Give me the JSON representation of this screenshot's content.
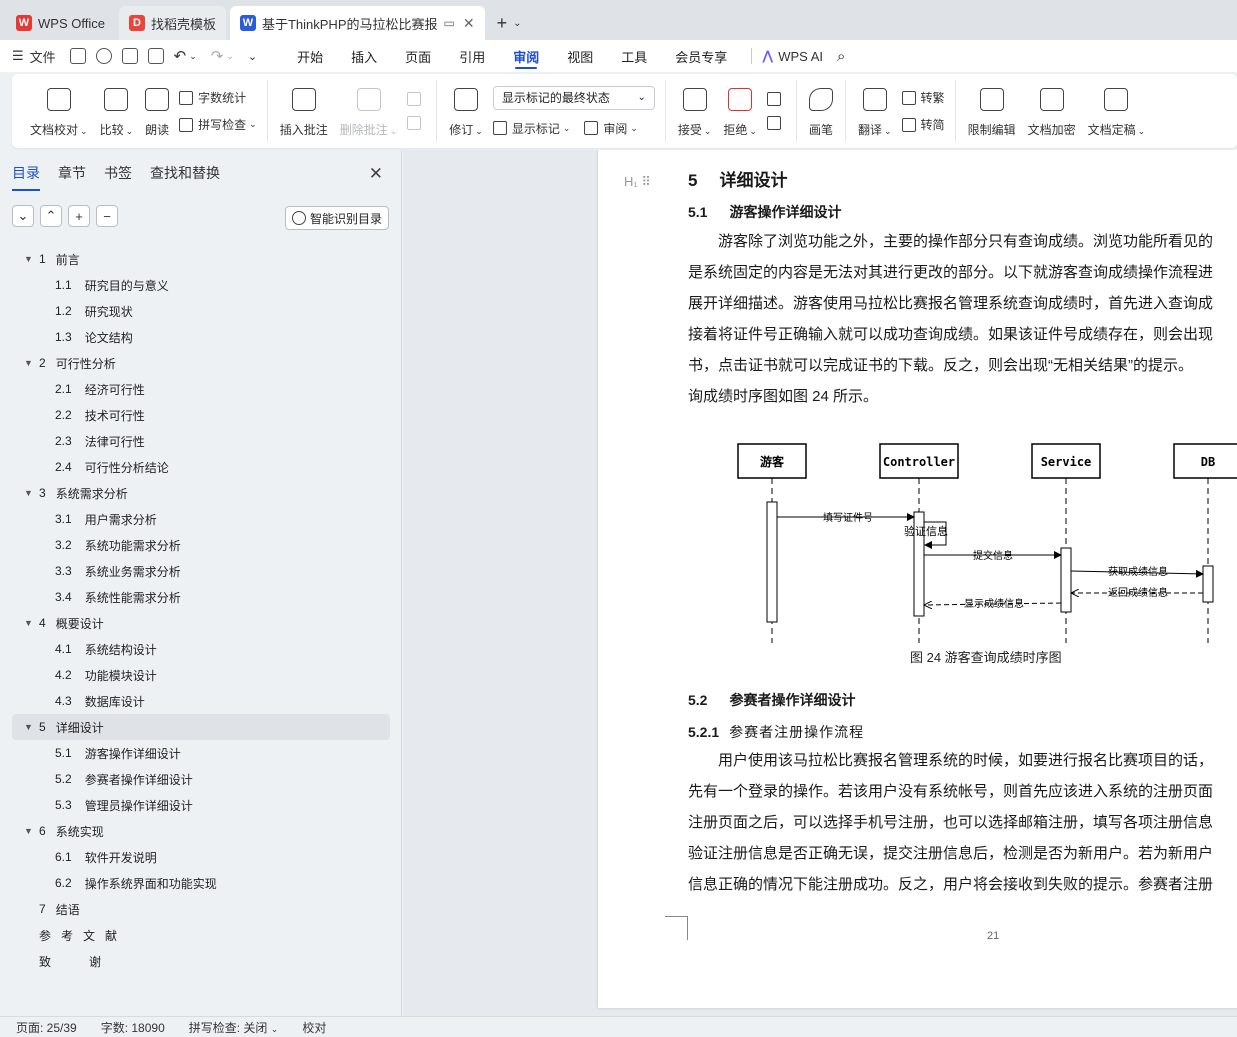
{
  "tabs": [
    {
      "label": "WPS Office",
      "icon": "wps-logo-icon"
    },
    {
      "label": "找稻壳模板",
      "icon": "docer-logo-icon"
    },
    {
      "label": "基于ThinkPHP的马拉松比赛报",
      "icon": "word-doc-icon",
      "active": true
    }
  ],
  "menubar": {
    "file": "文件",
    "tabs": [
      "开始",
      "插入",
      "页面",
      "引用",
      "审阅",
      "视图",
      "工具",
      "会员专享"
    ],
    "active_tab": "审阅",
    "wps_ai": "WPS AI"
  },
  "ribbon": {
    "doc_check": "文档校对",
    "compare": "比较",
    "read_aloud": "朗读",
    "word_count": "字数统计",
    "spell_check": "拼写检查",
    "insert_comment": "插入批注",
    "delete_comment": "删除批注",
    "track_changes": "修订",
    "display_select": "显示标记的最终状态",
    "show_markup": "显示标记",
    "review": "审阅",
    "accept": "接受",
    "reject": "拒绝",
    "ink": "画笔",
    "translate": "翻译",
    "to_traditional": "转繁",
    "to_simplified": "转简",
    "restrict_edit": "限制编辑",
    "encrypt": "文档加密",
    "finalize": "文档定稿"
  },
  "sidebar": {
    "tabs": [
      "目录",
      "章节",
      "书签",
      "查找和替换"
    ],
    "smart_btn": "智能识别目录",
    "toc": [
      {
        "level": 1,
        "num": "1",
        "text": "前言",
        "expand": true
      },
      {
        "level": 2,
        "num": "1.1",
        "text": "研究目的与意义"
      },
      {
        "level": 2,
        "num": "1.2",
        "text": "研究现状"
      },
      {
        "level": 2,
        "num": "1.3",
        "text": "论文结构"
      },
      {
        "level": 1,
        "num": "2",
        "text": "可行性分析",
        "expand": true
      },
      {
        "level": 2,
        "num": "2.1",
        "text": "经济可行性"
      },
      {
        "level": 2,
        "num": "2.2",
        "text": "技术可行性"
      },
      {
        "level": 2,
        "num": "2.3",
        "text": "法律可行性"
      },
      {
        "level": 2,
        "num": "2.4",
        "text": "可行性分析结论"
      },
      {
        "level": 1,
        "num": "3",
        "text": "系统需求分析",
        "expand": true
      },
      {
        "level": 2,
        "num": "3.1",
        "text": "用户需求分析"
      },
      {
        "level": 2,
        "num": "3.2",
        "text": "系统功能需求分析"
      },
      {
        "level": 2,
        "num": "3.3",
        "text": "系统业务需求分析"
      },
      {
        "level": 2,
        "num": "3.4",
        "text": "系统性能需求分析"
      },
      {
        "level": 1,
        "num": "4",
        "text": "概要设计",
        "expand": true
      },
      {
        "level": 2,
        "num": "4.1",
        "text": "系统结构设计"
      },
      {
        "level": 2,
        "num": "4.2",
        "text": "功能模块设计"
      },
      {
        "level": 2,
        "num": "4.3",
        "text": "数据库设计"
      },
      {
        "level": 1,
        "num": "5",
        "text": "详细设计",
        "expand": true,
        "selected": true
      },
      {
        "level": 2,
        "num": "5.1",
        "text": "游客操作详细设计"
      },
      {
        "level": 2,
        "num": "5.2",
        "text": "参赛者操作详细设计"
      },
      {
        "level": 2,
        "num": "5.3",
        "text": "管理员操作详细设计"
      },
      {
        "level": 1,
        "num": "6",
        "text": "系统实现",
        "expand": true
      },
      {
        "level": 2,
        "num": "6.1",
        "text": "软件开发说明"
      },
      {
        "level": 2,
        "num": "6.2",
        "text": "操作系统界面和功能实现"
      },
      {
        "level": 1,
        "num": "7",
        "text": "结语"
      },
      {
        "level": 1,
        "num": "",
        "text": "参考文献",
        "spaced": true
      },
      {
        "level": 1,
        "num": "",
        "text": "致谢",
        "wide": true
      }
    ]
  },
  "document": {
    "h1": {
      "num": "5",
      "text": "详细设计"
    },
    "h2a": {
      "num": "5.1",
      "text": "游客操作详细设计"
    },
    "para1": [
      "游客除了浏览功能之外，主要的操作部分只有查询成绩。浏览功能所看见的",
      "是系统固定的内容是无法对其进行更改的部分。以下就游客查询成绩操作流程进",
      "展开详细描述。游客使用马拉松比赛报名管理系统查询成绩时，首先进入查询成",
      "接着将证件号正确输入就可以成功查询成绩。如果该证件号成绩存在，则会出现",
      "书，点击证书就可以完成证书的下载。反之，则会出现“无相关结果”的提示。",
      "询成绩时序图如图 24 所示。"
    ],
    "diagram": {
      "actors": [
        "游客",
        "Controller",
        "Service",
        "DB"
      ],
      "messages": [
        "填写证件号",
        "验证信息",
        "提交信息",
        "获取成绩信息",
        "返回成绩信息",
        "显示成绩信息"
      ]
    },
    "caption": "图 24  游客查询成绩时序图",
    "h2b": {
      "num": "5.2",
      "text": "参赛者操作详细设计"
    },
    "h3": {
      "num": "5.2.1",
      "text": "参赛者注册操作流程"
    },
    "para2": [
      "用户使用该马拉松比赛报名管理系统的时候，如要进行报名比赛项目的话，",
      "先有一个登录的操作。若该用户没有系统帐号，则首先应该进入系统的注册页面",
      "注册页面之后，可以选择手机号注册，也可以选择邮箱注册，填写各项注册信息",
      "验证注册信息是否正确无误，提交注册信息后，检测是否为新用户。若为新用户",
      "信息正确的情况下能注册成功。反之，用户将会接收到失败的提示。参赛者注册"
    ],
    "page_number": "21"
  },
  "status": {
    "page": "页面: 25/39",
    "words": "字数: 18090",
    "spell": "拼写检查: 关闭",
    "proof": "校对"
  }
}
